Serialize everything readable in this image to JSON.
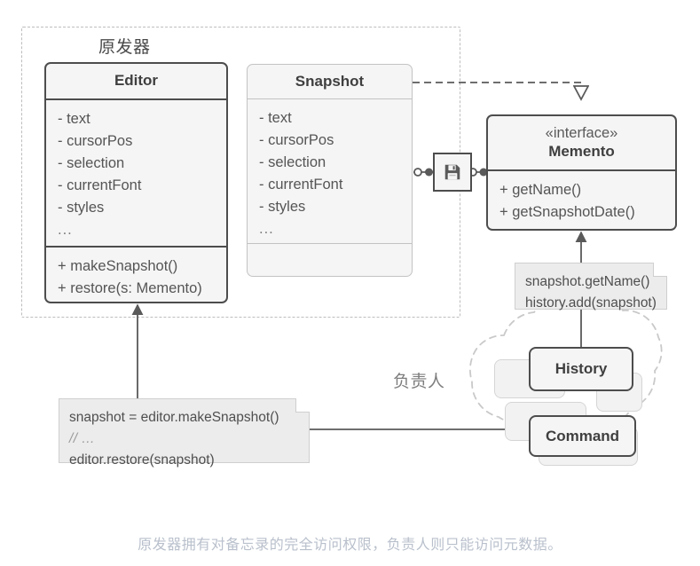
{
  "diagram": {
    "title_note": "UML class diagram of the Memento design pattern",
    "caption": "原发器拥有对备忘录的完全访问权限，负责人则只能访问元数据。",
    "packages": [
      {
        "id": "originator",
        "label": "原发器"
      }
    ],
    "zones": [
      {
        "id": "caretaker",
        "label": "负责人"
      }
    ],
    "classes": [
      {
        "id": "editor",
        "name": "Editor",
        "stereotype": "",
        "attributes": [
          "- text",
          "- cursorPos",
          "- selection",
          "- currentFont",
          "- styles",
          "..."
        ],
        "operations": [
          "+ makeSnapshot()",
          "+ restore(s: Memento)"
        ]
      },
      {
        "id": "snapshot",
        "name": "Snapshot",
        "stereotype": "",
        "attributes": [
          "- text",
          "- cursorPos",
          "- selection",
          "- currentFont",
          "- styles",
          "..."
        ],
        "operations": []
      },
      {
        "id": "memento",
        "name": "Memento",
        "stereotype": "«interface»",
        "attributes": [],
        "operations": [
          "+ getName()",
          "+ getSnapshotDate()"
        ]
      },
      {
        "id": "history",
        "name": "History",
        "stereotype": "",
        "attributes": [],
        "operations": []
      },
      {
        "id": "command",
        "name": "Command",
        "stereotype": "",
        "attributes": [],
        "operations": []
      }
    ],
    "notes": [
      {
        "id": "note-editor",
        "lines": [
          "snapshot = editor.makeSnapshot()",
          "// ...",
          "editor.restore(snapshot)"
        ]
      },
      {
        "id": "note-history",
        "lines": [
          "snapshot.getName()",
          "history.add(snapshot)"
        ]
      }
    ],
    "icons": [
      {
        "id": "memento-icon",
        "name": "floppy-disk-save-icon"
      }
    ],
    "colors": {
      "box_fill": "#f5f5f5",
      "box_border_dark": "#4d4d4d",
      "box_border_light": "#c3c3c3",
      "note_fill": "#ececec",
      "note_border": "#cfcfcf",
      "package_border": "#bdbdbd",
      "text": "#555555",
      "caption": "#b9c0cc",
      "link": "#5a5a5a"
    }
  }
}
